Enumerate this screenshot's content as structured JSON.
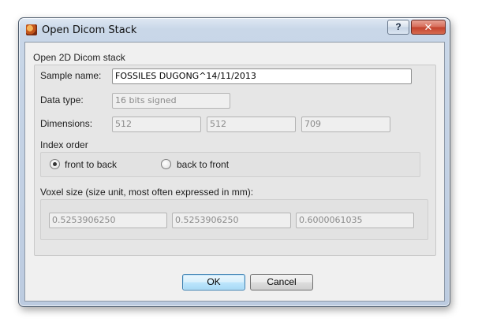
{
  "window": {
    "title": "Open Dicom Stack",
    "help_label": "?",
    "close_label": "✕"
  },
  "group": {
    "title": "Open 2D Dicom stack",
    "sample_name_label": "Sample name:",
    "sample_name_value": "FOSSILES DUGONG^14/11/2013",
    "data_type_label": "Data type:",
    "data_type_value": "16 bits signed",
    "dimensions_label": "Dimensions:",
    "dimensions": [
      "512",
      "512",
      "709"
    ],
    "index_order_label": "Index order",
    "radio_front": "front to back",
    "radio_back": "back to front",
    "radio_selected": "front to back",
    "voxel_label": "Voxel size (size unit, most often expressed in mm):",
    "voxel": [
      "0.5253906250",
      "0.5253906250",
      "0.6000061035"
    ]
  },
  "buttons": {
    "ok": "OK",
    "cancel": "Cancel"
  }
}
